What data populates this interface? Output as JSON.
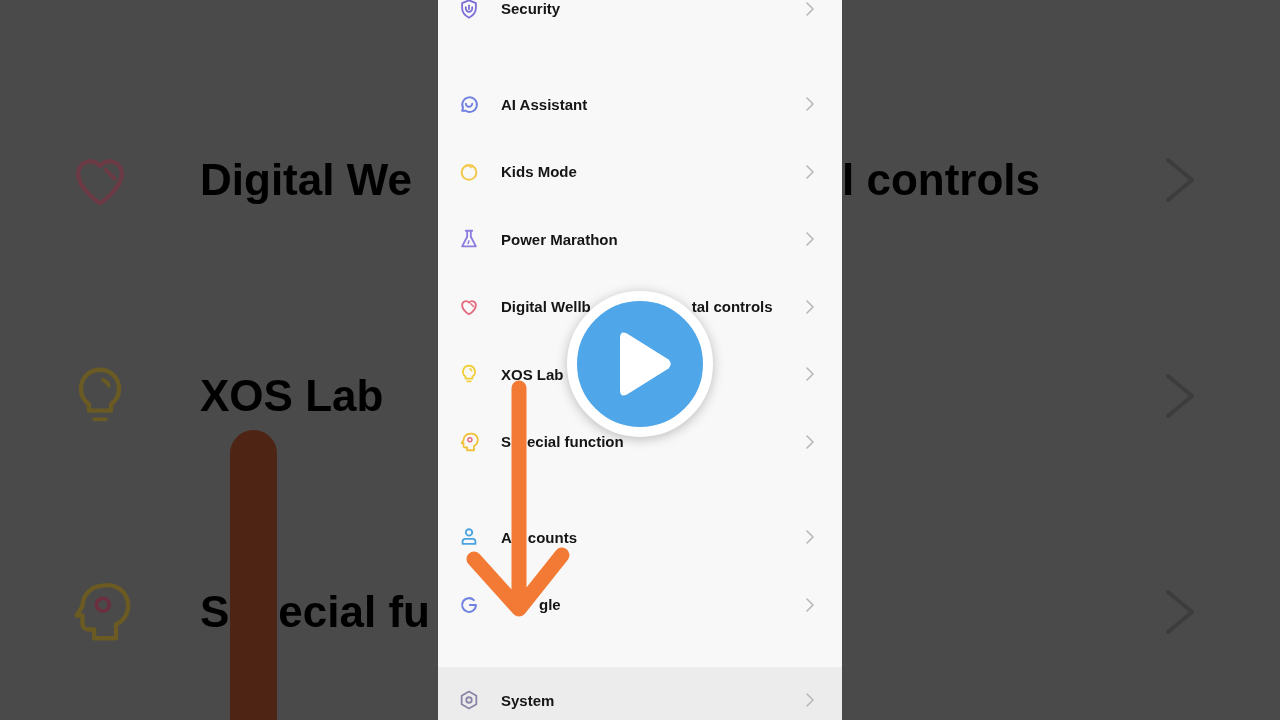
{
  "background": {
    "rows": [
      {
        "left_texts": [
          "Digital We"
        ],
        "right_text": "l controls"
      },
      {
        "left_texts": [
          "XOS Lab"
        ]
      },
      {
        "left_texts": [
          "S",
          "ecial fu"
        ]
      }
    ]
  },
  "settings": {
    "sections": [
      {
        "items": [
          {
            "label": "Security",
            "selected": false
          }
        ]
      },
      {
        "items": [
          {
            "label": "AI Assistant",
            "selected": false
          },
          {
            "label": "Kids Mode",
            "selected": false
          },
          {
            "label": "Power Marathon",
            "selected": false
          },
          {
            "label_parts": [
              "Digital Wellb",
              "tal controls"
            ],
            "selected": false
          },
          {
            "label": "XOS Lab",
            "selected": false
          },
          {
            "label_parts": [
              "S",
              "ecial function"
            ],
            "selected": false
          }
        ]
      },
      {
        "items": [
          {
            "label_parts": [
              "A",
              "counts"
            ],
            "selected": false
          },
          {
            "label": "gle",
            "selected": false
          }
        ]
      },
      {
        "items": [
          {
            "label": "System",
            "selected": true
          }
        ]
      }
    ]
  }
}
